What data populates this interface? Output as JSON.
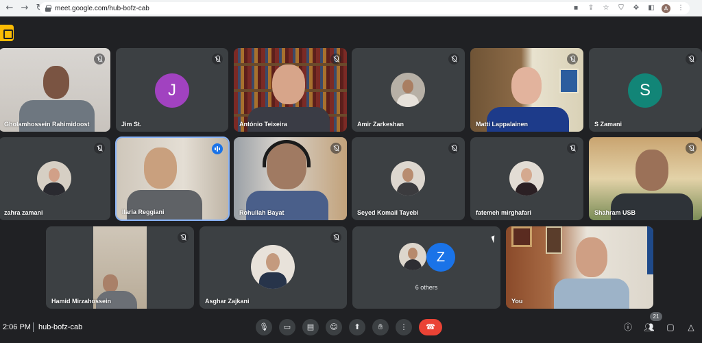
{
  "browser": {
    "url": "meet.google.com/hub-bofz-cab",
    "profile_initial": "A"
  },
  "tiles": [
    {
      "name": "Gholamhossein Rahimidoost",
      "type": "video"
    },
    {
      "name": "Jim St.",
      "type": "letter",
      "initial": "J",
      "color": "#a142c0"
    },
    {
      "name": "António Teixeira",
      "type": "video"
    },
    {
      "name": "Amir Zarkeshan",
      "type": "photo"
    },
    {
      "name": "Matti Lappalainen",
      "type": "video"
    },
    {
      "name": "S Zamani",
      "type": "letter",
      "initial": "S",
      "color": "#128577"
    },
    {
      "name": "zahra zamani",
      "type": "photo"
    },
    {
      "name": "Ilaria Reggiani",
      "type": "video",
      "speaking": true
    },
    {
      "name": "Rohullah Bayat",
      "type": "video"
    },
    {
      "name": "Seyed Komail Tayebi",
      "type": "photo"
    },
    {
      "name": "fatemeh mirghafari",
      "type": "photo"
    },
    {
      "name": "Shahram USB",
      "type": "video"
    },
    {
      "name": "Hamid Mirzahossein",
      "type": "video"
    },
    {
      "name": "Asghar Zajkani",
      "type": "photo"
    },
    {
      "name": "6 others",
      "type": "group",
      "initial": "Z",
      "color": "#1a73e8"
    },
    {
      "name": "You",
      "type": "video"
    }
  ],
  "bottom_bar": {
    "time": "2:06 PM",
    "meeting_code": "hub-bofz-cab",
    "participant_count": "21"
  },
  "colors": {
    "background": "#202124",
    "tile": "#3c4043",
    "end_call": "#ea4335",
    "speaking": "#1a73e8"
  }
}
